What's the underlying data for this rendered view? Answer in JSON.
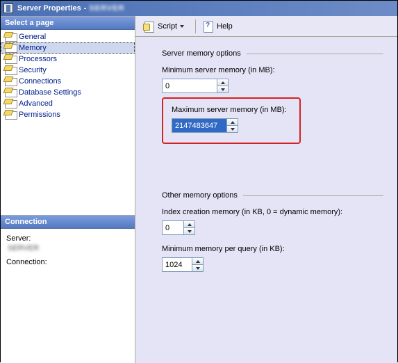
{
  "window": {
    "title_prefix": "Server Properties",
    "title_server": "SERVER"
  },
  "sidebar": {
    "select_page_header": "Select a page",
    "items": [
      {
        "label": "General"
      },
      {
        "label": "Memory"
      },
      {
        "label": "Processors"
      },
      {
        "label": "Security"
      },
      {
        "label": "Connections"
      },
      {
        "label": "Database Settings"
      },
      {
        "label": "Advanced"
      },
      {
        "label": "Permissions"
      }
    ],
    "selected_index": 1,
    "connection_header": "Connection",
    "server_label": "Server:",
    "server_value": "SERVER",
    "connection_label": "Connection:"
  },
  "toolbar": {
    "script_label": "Script",
    "help_label": "Help"
  },
  "content": {
    "server_memory_section": "Server memory options",
    "min_server_memory_label": "Minimum server memory (in MB):",
    "min_server_memory_value": "0",
    "max_server_memory_label": "Maximum server memory (in MB):",
    "max_server_memory_value": "2147483647",
    "other_memory_section": "Other memory options",
    "index_creation_label": "Index creation memory (in KB, 0 = dynamic memory):",
    "index_creation_value": "0",
    "min_query_label": "Minimum memory per query (in KB):",
    "min_query_value": "1024"
  }
}
